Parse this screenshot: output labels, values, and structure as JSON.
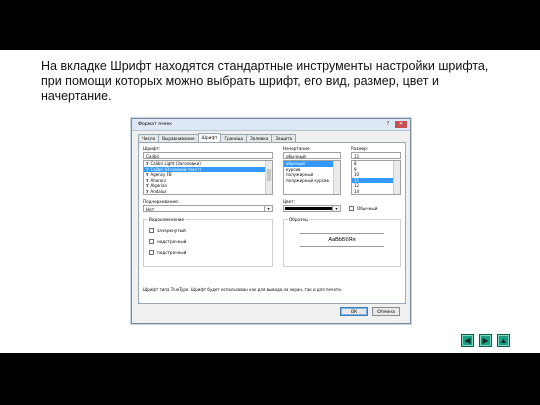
{
  "caption": "На вкладке Шрифт находятся стандартные инструменты настройки шрифта, при помощи которых можно выбрать шрифт, его вид, размер, цвет и начертание.",
  "dialog": {
    "title": "Формат ячеек",
    "help": "?",
    "close": "✕",
    "tabs": [
      "Число",
      "Выравнивание",
      "Шрифт",
      "Граница",
      "Заливка",
      "Защита"
    ],
    "font_label": "Шрифт:",
    "font_value": "Calibri",
    "font_list": [
      "Calibri Light (Заголовки)",
      "Calibri (Основной текст)",
      "Agency FB",
      "Aharoni",
      "Algerian",
      "Andalus"
    ],
    "font_list_selected": 1,
    "truetype_marker": "T",
    "style_label": "Начертание:",
    "style_value": "обычный",
    "style_list": [
      "обычный",
      "курсив",
      "полужирный",
      "полужирный курсив"
    ],
    "style_list_selected": 0,
    "size_label": "Размер:",
    "size_value": "11",
    "size_list": [
      "8",
      "9",
      "10",
      "11",
      "12",
      "14"
    ],
    "size_list_selected": 3,
    "underline_label": "Подчеркивание:",
    "underline_value": "Нет",
    "color_label": "Цвет:",
    "color_value": "#000000",
    "normal_font_label": "Обычный",
    "effects_title": "Видоизменение",
    "effects": [
      "зачеркнутый",
      "надстрочный",
      "подстрочный"
    ],
    "preview_title": "Образец",
    "preview_text": "AaBbБбЯя",
    "note": "Шрифт типа TrueType. Шрифт будет использован как для вывода на экран, так и для печати.",
    "ok_label": "ОК",
    "cancel_label": "Отмена"
  },
  "nav_buttons": [
    {
      "name": "prev-slide-button",
      "glyph": "◀"
    },
    {
      "name": "next-slide-button",
      "glyph": "▶"
    },
    {
      "name": "home-button",
      "glyph": "▲"
    }
  ],
  "colors": {
    "nav_accent": "#1d9e84",
    "selection": "#3399ff"
  }
}
